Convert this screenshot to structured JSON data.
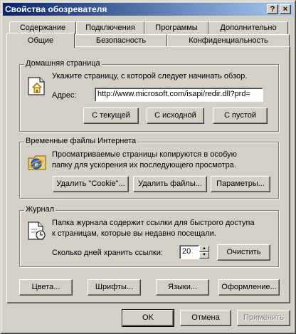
{
  "window": {
    "title": "Свойства обозревателя",
    "help_btn": "?",
    "close_btn": "×"
  },
  "tabs_back": [
    "Содержание",
    "Подключения",
    "Программы",
    "Дополнительно"
  ],
  "tabs_front": [
    "Общие",
    "Безопасность",
    "Конфиденциальность"
  ],
  "home": {
    "group_title": "Домашняя страница",
    "description": "Укажите страницу, с которой следует начинать обзор.",
    "address_label": "Адрес:",
    "address_value": "http://www.microsoft.com/isapi/redir.dll?prd=",
    "btn_current": "С текущей",
    "btn_default": "С исходной",
    "btn_blank": "С пустой"
  },
  "temp": {
    "group_title": "Временные файлы Интернета",
    "description_line1": "Просматриваемые страницы копируются в особую",
    "description_line2": "папку для ускорения их последующего просмотра.",
    "btn_cookies": "Удалить \"Cookie\"...",
    "btn_files": "Удалить файлы...",
    "btn_settings": "Параметры..."
  },
  "history": {
    "group_title": "Журнал",
    "description_line1": "Папка журнала содержит ссылки для быстрого доступа",
    "description_line2": "к страницам, которые вы недавно посещали.",
    "days_label": "Сколько дней хранить ссылки:",
    "days_value": "20",
    "btn_clear": "Очистить"
  },
  "bottom_buttons": {
    "colors": "Цвета...",
    "fonts": "Шрифты...",
    "languages": "Языки...",
    "accessibility": "Оформление..."
  },
  "dialog_buttons": {
    "ok": "OK",
    "cancel": "Отмена",
    "apply": "Применить"
  }
}
